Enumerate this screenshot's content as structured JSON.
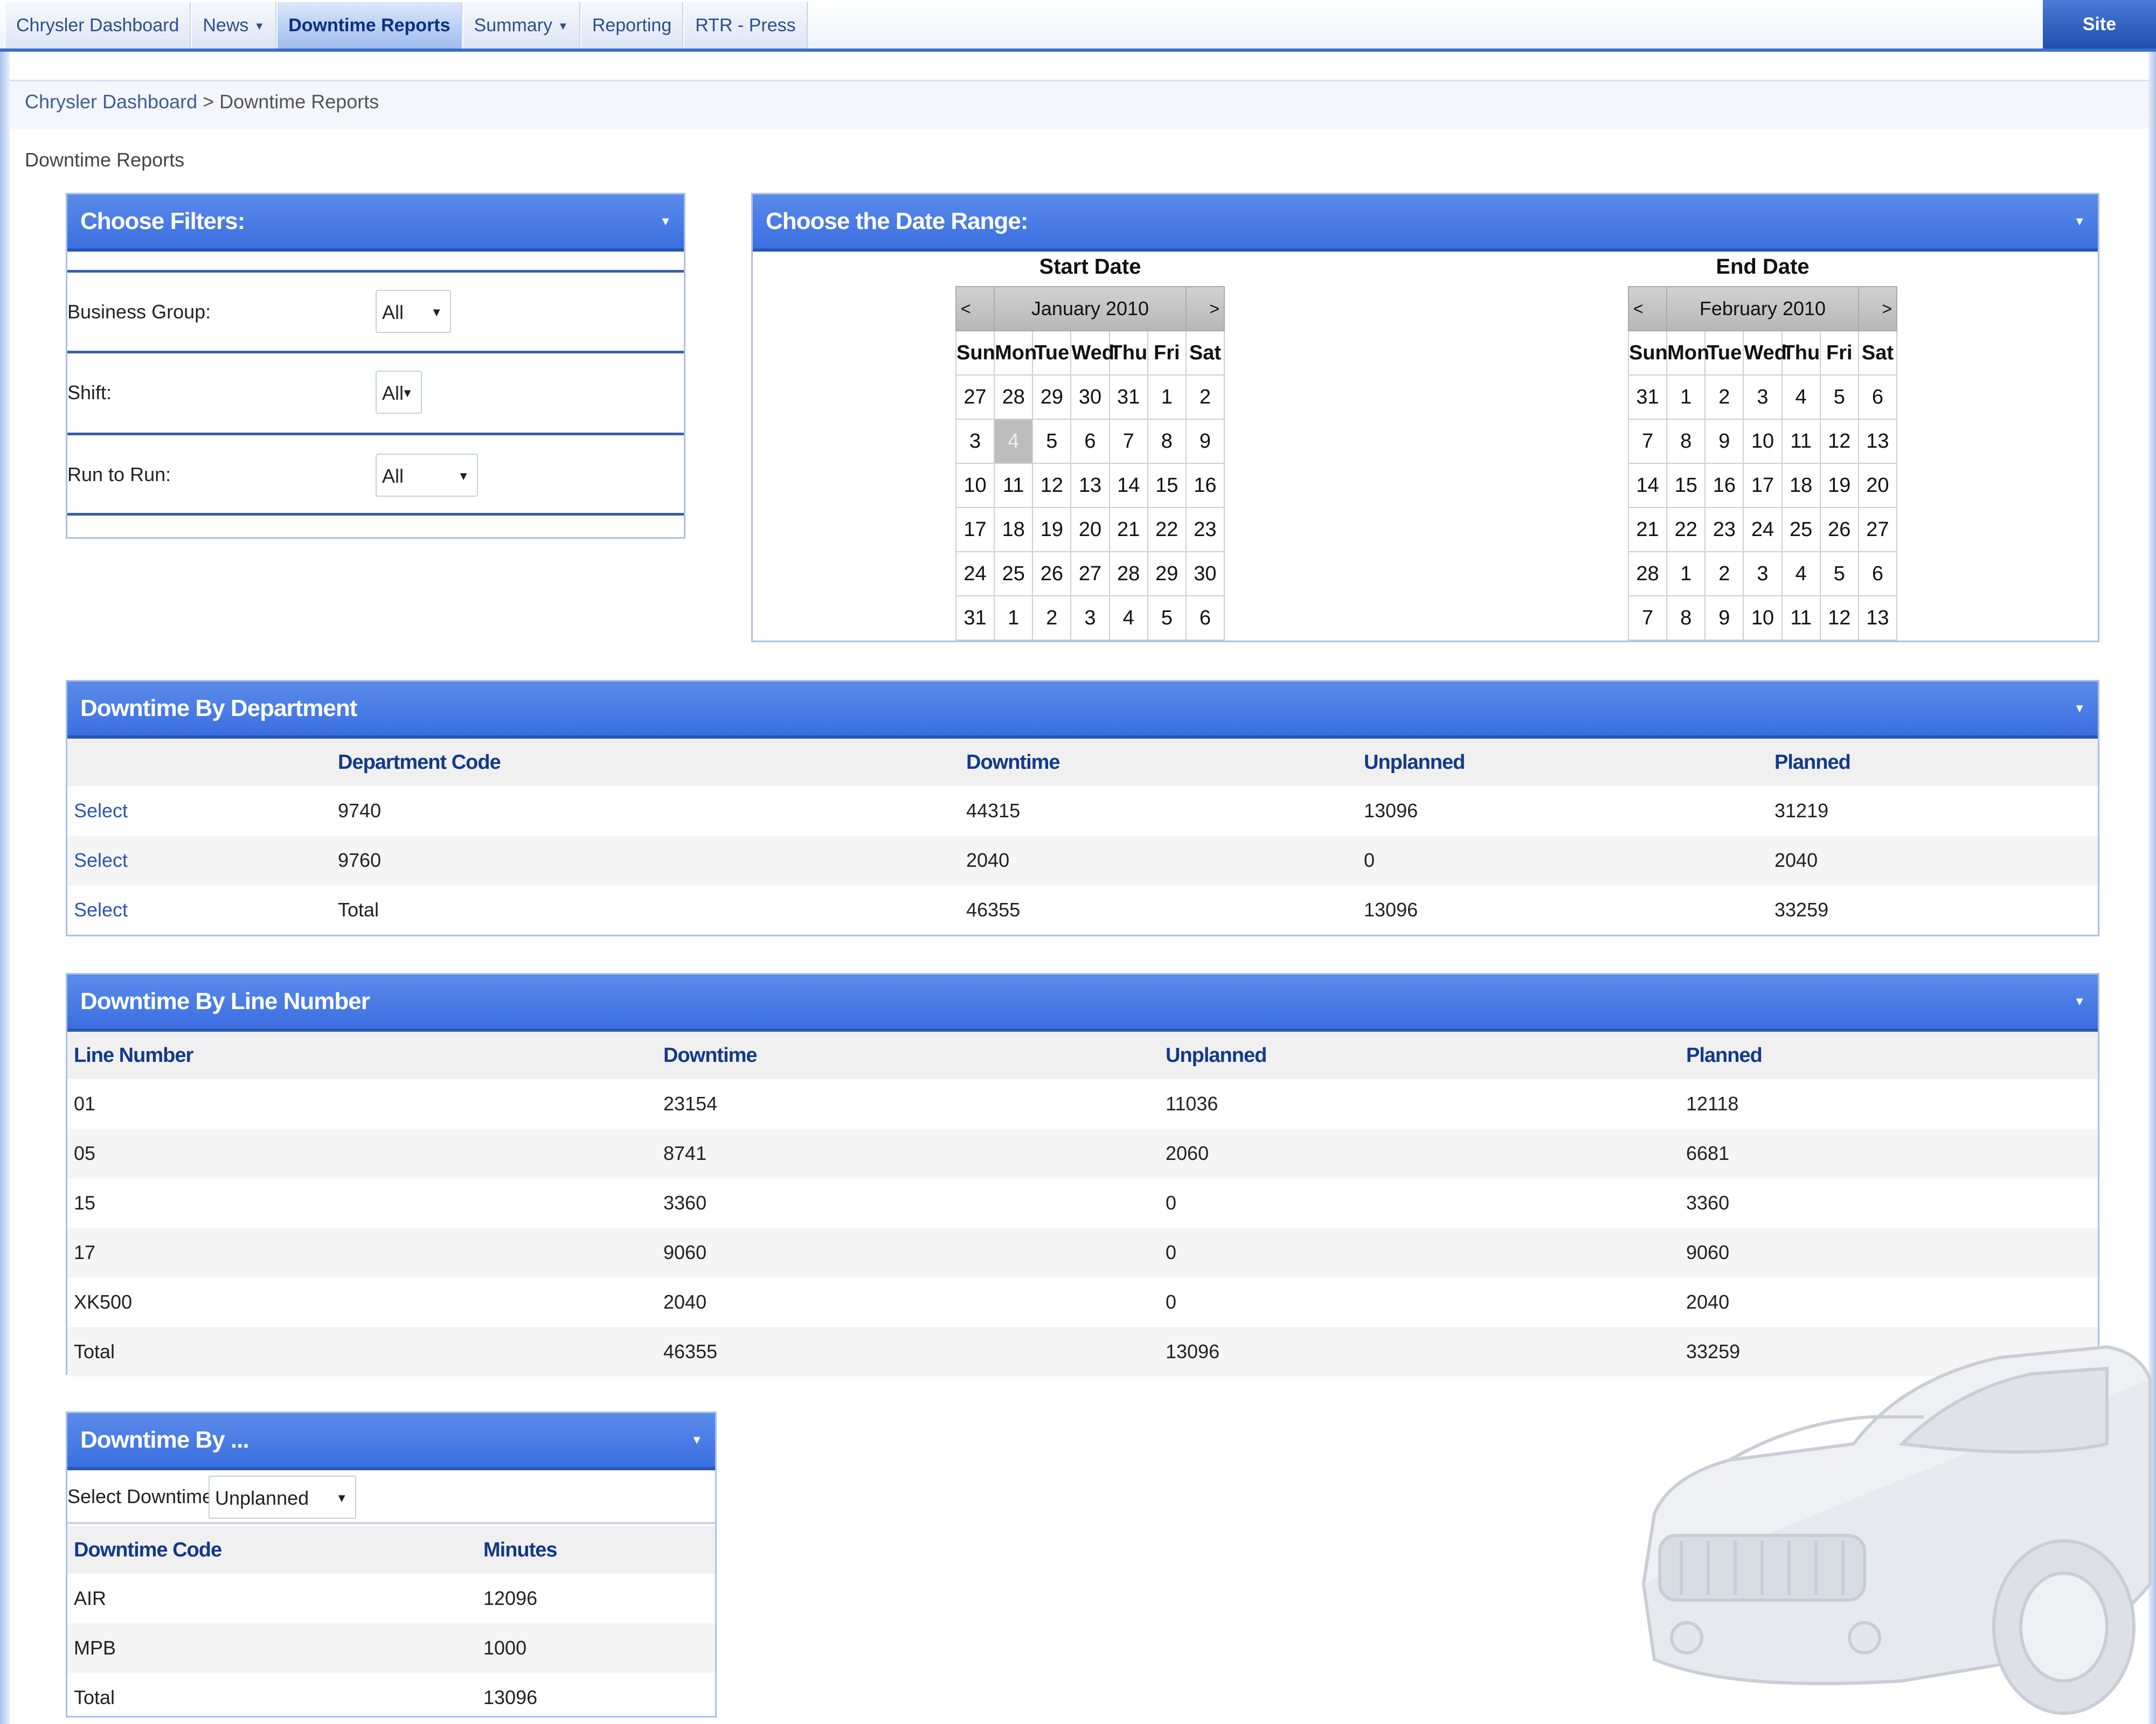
{
  "nav": {
    "tabs": [
      {
        "label": "Chrysler Dashboard",
        "caret": false
      },
      {
        "label": "News",
        "caret": true
      },
      {
        "label": "Downtime Reports",
        "caret": false,
        "active": true
      },
      {
        "label": "Summary",
        "caret": true
      },
      {
        "label": "Reporting",
        "caret": false
      },
      {
        "label": "RTR - Press",
        "caret": false
      }
    ],
    "site_actions": "Site Actions"
  },
  "breadcrumb": {
    "root": "Chrysler Dashboard",
    "sep": " > ",
    "current": "Downtime Reports"
  },
  "page_title": "Downtime Reports",
  "filters": {
    "title": "Choose Filters:",
    "business_group": {
      "label": "Business Group:",
      "value": "All"
    },
    "shift": {
      "label": "Shift:",
      "value": "All"
    },
    "run_to_run": {
      "label": "Run to Run:",
      "value": "All"
    }
  },
  "date_range": {
    "title": "Choose the Date Range:",
    "start": {
      "heading": "Start Date",
      "month": "January 2010",
      "prev": "<",
      "next": ">",
      "days": [
        "Sun",
        "Mon",
        "Tue",
        "Wed",
        "Thu",
        "Fri",
        "Sat"
      ],
      "weeks": [
        [
          "27",
          "28",
          "29",
          "30",
          "31",
          "1",
          "2"
        ],
        [
          "3",
          "4",
          "5",
          "6",
          "7",
          "8",
          "9"
        ],
        [
          "10",
          "11",
          "12",
          "13",
          "14",
          "15",
          "16"
        ],
        [
          "17",
          "18",
          "19",
          "20",
          "21",
          "22",
          "23"
        ],
        [
          "24",
          "25",
          "26",
          "27",
          "28",
          "29",
          "30"
        ],
        [
          "31",
          "1",
          "2",
          "3",
          "4",
          "5",
          "6"
        ]
      ],
      "selected_day": "4"
    },
    "end": {
      "heading": "End Date",
      "month": "February 2010",
      "prev": "<",
      "next": ">",
      "days": [
        "Sun",
        "Mon",
        "Tue",
        "Wed",
        "Thu",
        "Fri",
        "Sat"
      ],
      "weeks": [
        [
          "31",
          "1",
          "2",
          "3",
          "4",
          "5",
          "6"
        ],
        [
          "7",
          "8",
          "9",
          "10",
          "11",
          "12",
          "13"
        ],
        [
          "14",
          "15",
          "16",
          "17",
          "18",
          "19",
          "20"
        ],
        [
          "21",
          "22",
          "23",
          "24",
          "25",
          "26",
          "27"
        ],
        [
          "28",
          "1",
          "2",
          "3",
          "4",
          "5",
          "6"
        ],
        [
          "7",
          "8",
          "9",
          "10",
          "11",
          "12",
          "13"
        ]
      ]
    }
  },
  "by_department": {
    "title": "Downtime By Department",
    "columns": [
      "Department Code",
      "Downtime",
      "Unplanned",
      "Planned"
    ],
    "rows": [
      {
        "action": "Select",
        "code": "9740",
        "downtime": "44315",
        "unplanned": "13096",
        "planned": "31219"
      },
      {
        "action": "Select",
        "code": "9760",
        "downtime": "2040",
        "unplanned": "0",
        "planned": "2040"
      },
      {
        "action": "Select",
        "code": "Total",
        "downtime": "46355",
        "unplanned": "13096",
        "planned": "33259"
      }
    ]
  },
  "by_line": {
    "title": "Downtime By Line Number",
    "columns": [
      "Line Number",
      "Downtime",
      "Unplanned",
      "Planned"
    ],
    "rows": [
      {
        "line": "01",
        "downtime": "23154",
        "unplanned": "11036",
        "planned": "12118"
      },
      {
        "line": "05",
        "downtime": "8741",
        "unplanned": "2060",
        "planned": "6681"
      },
      {
        "line": "15",
        "downtime": "3360",
        "unplanned": "0",
        "planned": "3360"
      },
      {
        "line": "17",
        "downtime": "9060",
        "unplanned": "0",
        "planned": "9060"
      },
      {
        "line": "XK500",
        "downtime": "2040",
        "unplanned": "0",
        "planned": "2040"
      },
      {
        "line": "Total",
        "downtime": "46355",
        "unplanned": "13096",
        "planned": "33259"
      }
    ]
  },
  "by_other": {
    "title": "Downtime By ...",
    "select_label": "Select Downtime By:",
    "select_value": "Unplanned Codes",
    "columns": [
      "Downtime Code",
      "Minutes"
    ],
    "rows": [
      {
        "code": "AIR",
        "minutes": "12096"
      },
      {
        "code": "MPB",
        "minutes": "1000"
      },
      {
        "code": "Total",
        "minutes": "13096"
      }
    ]
  },
  "icons": {
    "dropdown": "chevron-down-icon",
    "webpart_menu": "webpart-menu-icon",
    "car": "car-watermark"
  },
  "colors": {
    "header_blue": "#3a6fe0",
    "link_blue": "#2d56b5",
    "column_header": "#123a8a"
  }
}
